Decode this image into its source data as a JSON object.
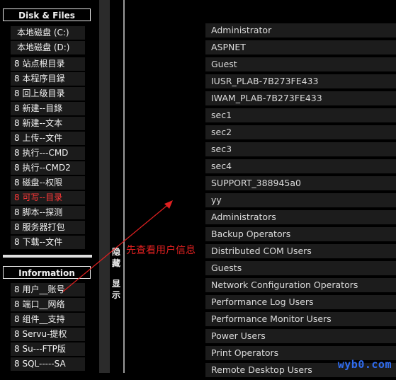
{
  "sections": {
    "disk": {
      "title": "Disk & Files",
      "drives": [
        "本地磁盘 (C:)",
        "本地磁盘 (D:)"
      ],
      "items": [
        {
          "label": "8 站点根目录"
        },
        {
          "label": "8 本程序目録"
        },
        {
          "label": "8 回上级目录"
        },
        {
          "label": "8 新建--目錄"
        },
        {
          "label": "8 新建--文本"
        },
        {
          "label": "8 上传--文件"
        },
        {
          "label": "8 执行---CMD"
        },
        {
          "label": "8 执行--CMD2"
        },
        {
          "label": "8 磁盘--权限"
        },
        {
          "label": "8 可写--目录",
          "highlight": true
        },
        {
          "label": "8 脚本--探测"
        },
        {
          "label": "8 服务器打包"
        },
        {
          "label": "8 下载--文件"
        }
      ]
    },
    "info": {
      "title": "Information",
      "items": [
        {
          "label": "8 用户__账号"
        },
        {
          "label": "8 端口__网络"
        },
        {
          "label": "8 组件__支持"
        },
        {
          "label": "8 Servu-提权"
        },
        {
          "label": "8 Su---FTP版"
        },
        {
          "label": "8 SQL-----SA"
        }
      ]
    }
  },
  "toggle": {
    "hide": [
      "隐",
      "藏"
    ],
    "show": [
      "显",
      "示"
    ]
  },
  "users": [
    "Administrator",
    "ASPNET",
    "Guest",
    "IUSR_PLAB-7B273FE433",
    "IWAM_PLAB-7B273FE433",
    "sec1",
    "sec2",
    "sec3",
    "sec4",
    "SUPPORT_388945a0",
    "yy",
    "Administrators",
    "Backup Operators",
    "Distributed COM Users",
    "Guests",
    "Network Configuration Operators",
    "Performance Log Users",
    "Performance Monitor Users",
    "Power Users",
    "Print Operators",
    "Remote Desktop Users"
  ],
  "annotation": {
    "text": "先查看用户信息",
    "color": "#e02020"
  },
  "watermark": "wyb0.com",
  "colors": {
    "highlight_red": "#ff3838",
    "watermark_blue": "#2f6cf0"
  }
}
